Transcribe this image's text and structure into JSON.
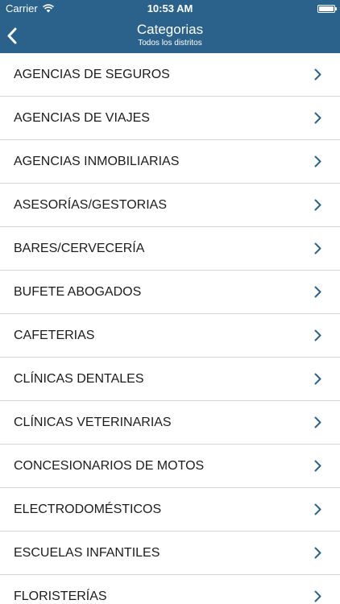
{
  "status_bar": {
    "carrier": "Carrier",
    "time": "10:53 AM",
    "battery_level": 1.0
  },
  "header": {
    "title": "Categorias",
    "subtitle": "Todos los distritos",
    "background_color": "#2a628c",
    "back_icon": "chevron-left-icon"
  },
  "categories": [
    {
      "label": "AGENCIAS DE SEGUROS"
    },
    {
      "label": "AGENCIAS DE VIAJES"
    },
    {
      "label": "AGENCIAS INMOBILIARIAS"
    },
    {
      "label": "ASESORÍAS/GESTORIAS"
    },
    {
      "label": "BARES/CERVECERÍA"
    },
    {
      "label": "BUFETE ABOGADOS"
    },
    {
      "label": "CAFETERIAS"
    },
    {
      "label": "CLÍNICAS DENTALES"
    },
    {
      "label": "CLÍNICAS VETERINARIAS"
    },
    {
      "label": "CONCESIONARIOS DE MOTOS"
    },
    {
      "label": "ELECTRODOMÉSTICOS"
    },
    {
      "label": "ESCUELAS INFANTILES"
    },
    {
      "label": "FLORISTERÍAS"
    }
  ],
  "accent_color": "#2a628c",
  "row_icon": "chevron-right-icon"
}
